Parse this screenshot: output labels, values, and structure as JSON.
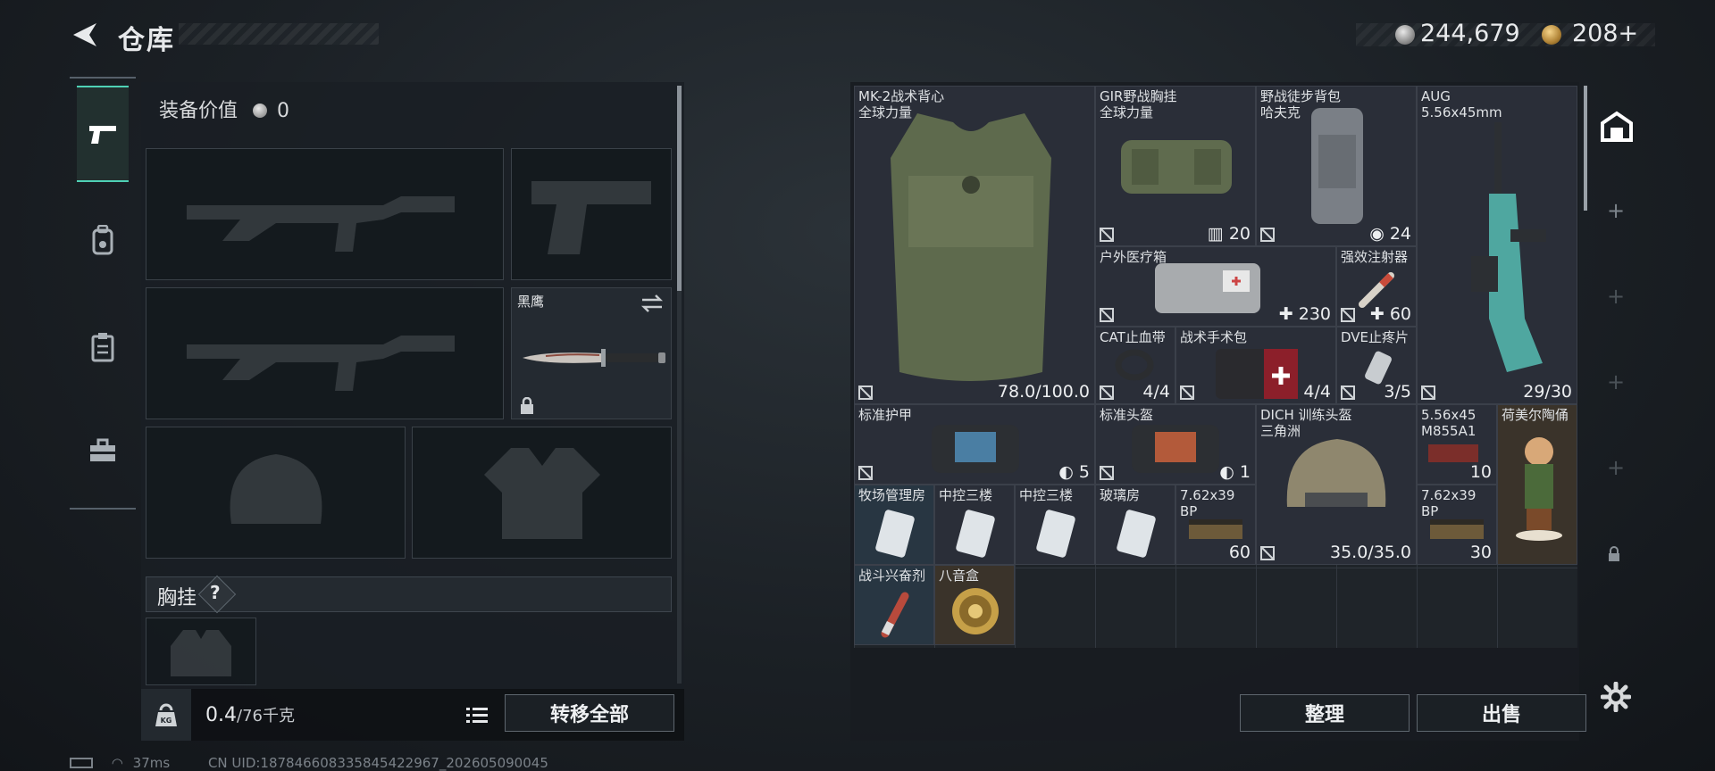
{
  "header": {
    "title": "仓库",
    "currency": [
      {
        "icon": "silver-coin-icon",
        "value": "244,679"
      },
      {
        "icon": "gold-coin-icon",
        "value": "208+"
      }
    ]
  },
  "loadout": {
    "equipment_value_label": "装备价值",
    "equipment_value": "0",
    "melee_name": "黑鹰",
    "chest_rig_label": "胸挂",
    "help_mark": "?",
    "weight": "0.4",
    "weight_max": "/76千克",
    "transfer_all": "转移全部"
  },
  "stash": {
    "items": [
      {
        "id": "mk2",
        "name": "MK-2战术背心",
        "sub": "全球力量",
        "value": "78.0/100.0"
      },
      {
        "id": "gir",
        "name": "GIR野战胸挂",
        "sub": "全球力量",
        "value": "20"
      },
      {
        "id": "hiker",
        "name": "野战徒步背包",
        "sub": "哈夫克",
        "value": "24"
      },
      {
        "id": "aug",
        "name": "AUG",
        "sub": "5.56x45mm",
        "value": "29/30"
      },
      {
        "id": "medkit",
        "name": "户外医疗箱",
        "sub": "",
        "value": "230"
      },
      {
        "id": "injector",
        "name": "强效注射器",
        "sub": "",
        "value": "60"
      },
      {
        "id": "cat",
        "name": "CAT止血带",
        "sub": "",
        "value": "4/4"
      },
      {
        "id": "surgical",
        "name": "战术手术包",
        "sub": "",
        "value": "4/4"
      },
      {
        "id": "dve",
        "name": "DVE止疼片",
        "sub": "",
        "value": "3/5"
      },
      {
        "id": "armor",
        "name": "标准护甲",
        "sub": "",
        "value": "5"
      },
      {
        "id": "helmet",
        "name": "标准头盔",
        "sub": "",
        "value": "1"
      },
      {
        "id": "dich",
        "name": "DICH 训练头盔",
        "sub": "三角洲",
        "value": "35.0/35.0"
      },
      {
        "id": "m855",
        "name": "5.56x45",
        "sub": "M855A1",
        "value": "10"
      },
      {
        "id": "hummel",
        "name": "荷美尔陶俑",
        "sub": "",
        "value": ""
      },
      {
        "id": "ranch",
        "name": "牧场管理房",
        "sub": "",
        "value": ""
      },
      {
        "id": "ctrl1",
        "name": "中控三楼",
        "sub": "",
        "value": ""
      },
      {
        "id": "ctrl2",
        "name": "中控三楼",
        "sub": "",
        "value": ""
      },
      {
        "id": "glass",
        "name": "玻璃房",
        "sub": "",
        "value": ""
      },
      {
        "id": "bp1",
        "name": "7.62x39",
        "sub": "BP",
        "value": "60"
      },
      {
        "id": "bp2",
        "name": "7.62x39",
        "sub": "BP",
        "value": "30"
      },
      {
        "id": "stim",
        "name": "战斗兴奋剂",
        "sub": "",
        "value": ""
      },
      {
        "id": "musicbox",
        "name": "八音盒",
        "sub": "",
        "value": ""
      }
    ],
    "sort_button": "整理",
    "sell_button": "出售"
  },
  "status": {
    "ping": "37ms",
    "uid": "CN UID:187846608335845422967_202605090045"
  },
  "colors": {
    "accent": "#4fd1b5",
    "panel": "#1f2429",
    "item_bg": "#2a2e38"
  }
}
